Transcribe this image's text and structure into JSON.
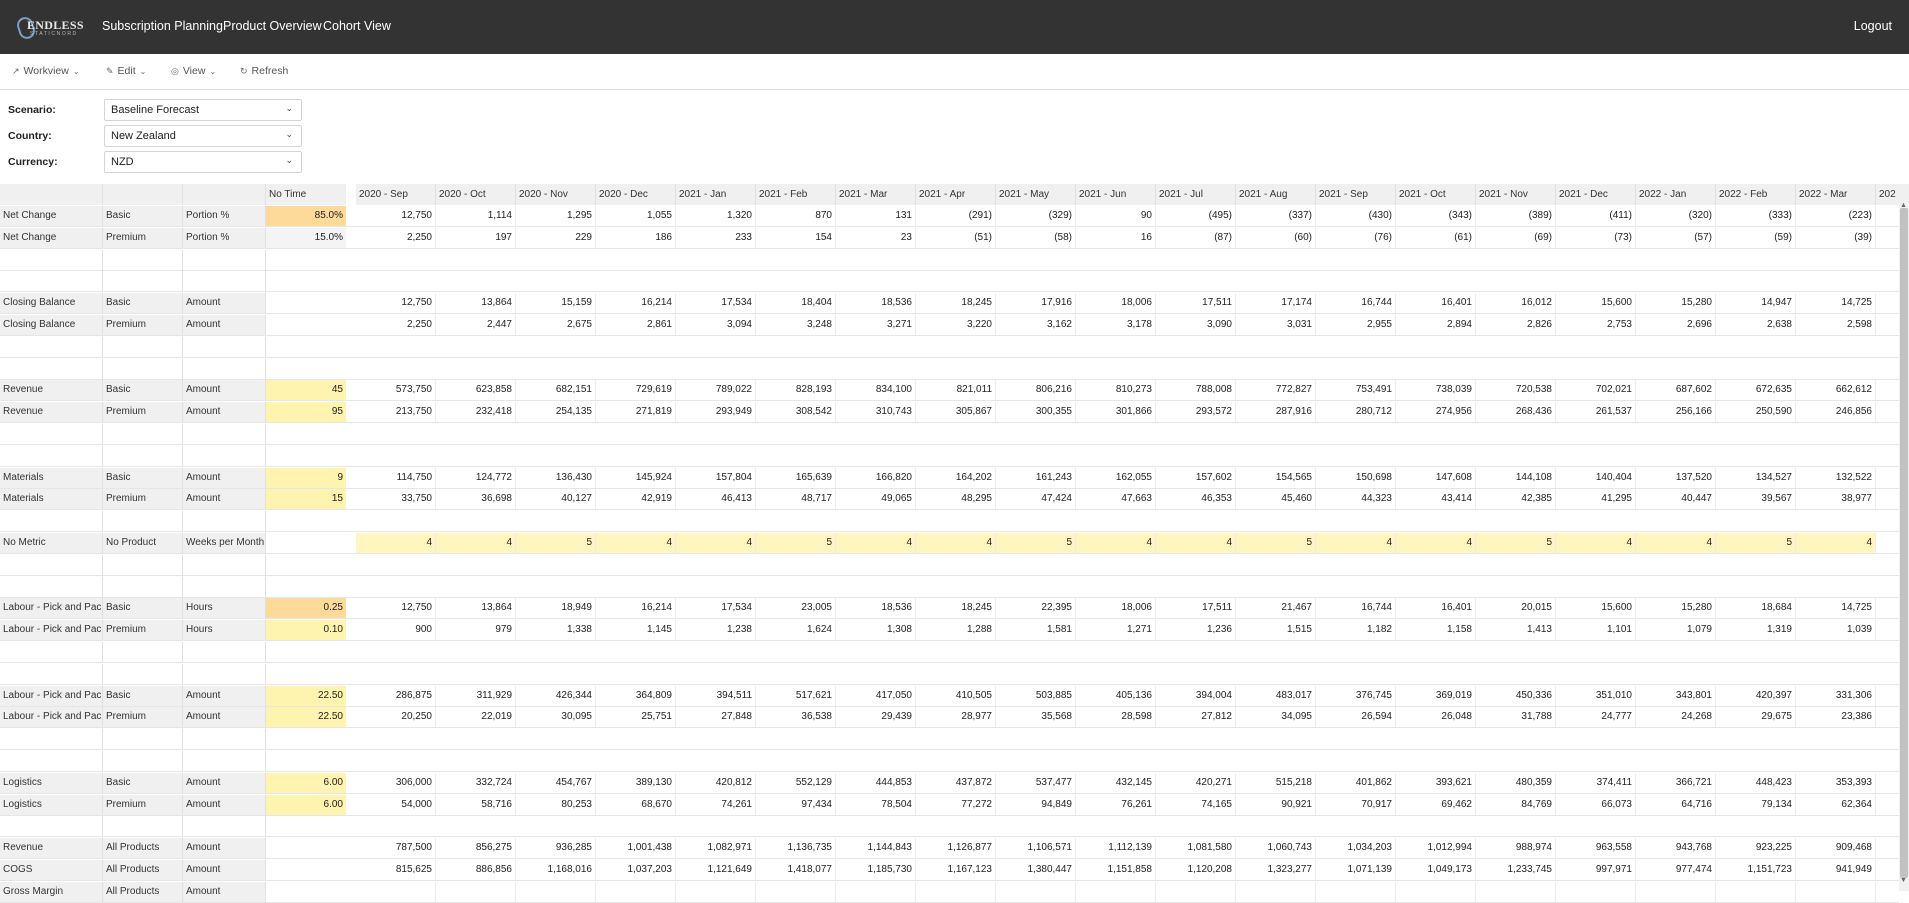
{
  "app": {
    "logo_text": "ENDLESS",
    "logo_subtext": "STATICNORD",
    "nav": [
      "Subscription Planning",
      "Product Overview",
      "Cohort View"
    ],
    "logout": "Logout"
  },
  "toolbar": [
    "Workview",
    "Edit",
    "View",
    "Refresh"
  ],
  "filters": [
    {
      "label": "Scenario:",
      "value": "Baseline Forecast"
    },
    {
      "label": "Country:",
      "value": "New Zealand"
    },
    {
      "label": "Currency:",
      "value": "NZD"
    }
  ],
  "grid": {
    "no_time_header": "No Time",
    "columns": [
      "2020 - Sep",
      "2020 - Oct",
      "2020 - Nov",
      "2020 - Dec",
      "2021 - Jan",
      "2021 - Feb",
      "2021 - Mar",
      "2021 - Apr",
      "2021 - May",
      "2021 - Jun",
      "2021 - Jul",
      "2021 - Aug",
      "2021 - Sep",
      "2021 - Oct",
      "2021 - Nov",
      "2021 - Dec",
      "2022 - Jan",
      "2022 - Feb",
      "2022 - Mar",
      "202"
    ],
    "rows": [
      {
        "m": "Net Change",
        "p": "Basic",
        "t": "Portion %",
        "nt": "85.0%",
        "ntc": "#fdd99a",
        "v": [
          "12,750",
          "1,114",
          "1,295",
          "1,055",
          "1,320",
          "870",
          "131",
          "(291)",
          "(329)",
          "90",
          "(495)",
          "(337)",
          "(430)",
          "(343)",
          "(389)",
          "(411)",
          "(320)",
          "(333)",
          "(223)"
        ]
      },
      {
        "m": "Net Change",
        "p": "Premium",
        "t": "Portion %",
        "nt": "15.0%",
        "ntc": "#f4f4f4",
        "v": [
          "2,250",
          "197",
          "229",
          "186",
          "233",
          "154",
          "23",
          "(51)",
          "(58)",
          "16",
          "(87)",
          "(60)",
          "(76)",
          "(61)",
          "(69)",
          "(73)",
          "(57)",
          "(59)",
          "(39)"
        ]
      },
      {
        "blank": true
      },
      {
        "blank": true
      },
      {
        "m": "Closing Balance",
        "p": "Basic",
        "t": "Amount",
        "v": [
          "12,750",
          "13,864",
          "15,159",
          "16,214",
          "17,534",
          "18,404",
          "18,536",
          "18,245",
          "17,916",
          "18,006",
          "17,511",
          "17,174",
          "16,744",
          "16,401",
          "16,012",
          "15,600",
          "15,280",
          "14,947",
          "14,725"
        ]
      },
      {
        "m": "Closing Balance",
        "p": "Premium",
        "t": "Amount",
        "v": [
          "2,250",
          "2,447",
          "2,675",
          "2,861",
          "3,094",
          "3,248",
          "3,271",
          "3,220",
          "3,162",
          "3,178",
          "3,090",
          "3,031",
          "2,955",
          "2,894",
          "2,826",
          "2,753",
          "2,696",
          "2,638",
          "2,598"
        ]
      },
      {
        "blank": true
      },
      {
        "blank": true
      },
      {
        "m": "Revenue",
        "p": "Basic",
        "t": "Amount",
        "nt": "45",
        "ntc": "#fff3b0",
        "v": [
          "573,750",
          "623,858",
          "682,151",
          "729,619",
          "789,022",
          "828,193",
          "834,100",
          "821,011",
          "806,216",
          "810,273",
          "788,008",
          "772,827",
          "753,491",
          "738,039",
          "720,538",
          "702,021",
          "687,602",
          "672,635",
          "662,612"
        ]
      },
      {
        "m": "Revenue",
        "p": "Premium",
        "t": "Amount",
        "nt": "95",
        "ntc": "#fff3b0",
        "v": [
          "213,750",
          "232,418",
          "254,135",
          "271,819",
          "293,949",
          "308,542",
          "310,743",
          "305,867",
          "300,355",
          "301,866",
          "293,572",
          "287,916",
          "280,712",
          "274,956",
          "268,436",
          "261,537",
          "256,166",
          "250,590",
          "246,856"
        ]
      },
      {
        "blank": true
      },
      {
        "blank": true
      },
      {
        "m": "Materials",
        "p": "Basic",
        "t": "Amount",
        "nt": "9",
        "ntc": "#fff3b0",
        "v": [
          "114,750",
          "124,772",
          "136,430",
          "145,924",
          "157,804",
          "165,639",
          "166,820",
          "164,202",
          "161,243",
          "162,055",
          "157,602",
          "154,565",
          "150,698",
          "147,608",
          "144,108",
          "140,404",
          "137,520",
          "134,527",
          "132,522"
        ]
      },
      {
        "m": "Materials",
        "p": "Premium",
        "t": "Amount",
        "nt": "15",
        "ntc": "#fff3b0",
        "v": [
          "33,750",
          "36,698",
          "40,127",
          "42,919",
          "46,413",
          "48,717",
          "49,065",
          "48,295",
          "47,424",
          "47,663",
          "46,353",
          "45,460",
          "44,323",
          "43,414",
          "42,385",
          "41,295",
          "40,447",
          "39,567",
          "38,977"
        ]
      },
      {
        "blank": true
      },
      {
        "m": "No Metric",
        "p": "No Product",
        "t": "Weeks per Month",
        "yellow": true,
        "v": [
          "4",
          "4",
          "5",
          "4",
          "4",
          "5",
          "4",
          "4",
          "5",
          "4",
          "4",
          "5",
          "4",
          "4",
          "5",
          "4",
          "4",
          "5",
          "4"
        ]
      },
      {
        "blank": true
      },
      {
        "blank": true
      },
      {
        "m": "Labour - Pick and Pack",
        "p": "Basic",
        "t": "Hours",
        "nt": "0.25",
        "ntc": "#fdd99a",
        "v": [
          "12,750",
          "13,864",
          "18,949",
          "16,214",
          "17,534",
          "23,005",
          "18,536",
          "18,245",
          "22,395",
          "18,006",
          "17,511",
          "21,467",
          "16,744",
          "16,401",
          "20,015",
          "15,600",
          "15,280",
          "18,684",
          "14,725"
        ]
      },
      {
        "m": "Labour - Pick and Pack",
        "p": "Premium",
        "t": "Hours",
        "nt": "0.10",
        "ntc": "#fff3b0",
        "v": [
          "900",
          "979",
          "1,338",
          "1,145",
          "1,238",
          "1,624",
          "1,308",
          "1,288",
          "1,581",
          "1,271",
          "1,236",
          "1,515",
          "1,182",
          "1,158",
          "1,413",
          "1,101",
          "1,079",
          "1,319",
          "1,039"
        ]
      },
      {
        "blank": true
      },
      {
        "blank": true
      },
      {
        "m": "Labour - Pick and Pack",
        "p": "Basic",
        "t": "Amount",
        "nt": "22.50",
        "ntc": "#fff3b0",
        "v": [
          "286,875",
          "311,929",
          "426,344",
          "364,809",
          "394,511",
          "517,621",
          "417,050",
          "410,505",
          "503,885",
          "405,136",
          "394,004",
          "483,017",
          "376,745",
          "369,019",
          "450,336",
          "351,010",
          "343,801",
          "420,397",
          "331,306"
        ]
      },
      {
        "m": "Labour - Pick and Pack",
        "p": "Premium",
        "t": "Amount",
        "nt": "22.50",
        "ntc": "#fff3b0",
        "v": [
          "20,250",
          "22,019",
          "30,095",
          "25,751",
          "27,848",
          "36,538",
          "29,439",
          "28,977",
          "35,568",
          "28,598",
          "27,812",
          "34,095",
          "26,594",
          "26,048",
          "31,788",
          "24,777",
          "24,268",
          "29,675",
          "23,386"
        ]
      },
      {
        "blank": true
      },
      {
        "blank": true
      },
      {
        "m": "Logistics",
        "p": "Basic",
        "t": "Amount",
        "nt": "6.00",
        "ntc": "#fff3b0",
        "v": [
          "306,000",
          "332,724",
          "454,767",
          "389,130",
          "420,812",
          "552,129",
          "444,853",
          "437,872",
          "537,477",
          "432,145",
          "420,271",
          "515,218",
          "401,862",
          "393,621",
          "480,359",
          "374,411",
          "366,721",
          "448,423",
          "353,393"
        ]
      },
      {
        "m": "Logistics",
        "p": "Premium",
        "t": "Amount",
        "nt": "6.00",
        "ntc": "#fff3b0",
        "v": [
          "54,000",
          "58,716",
          "80,253",
          "68,670",
          "74,261",
          "97,434",
          "78,504",
          "77,272",
          "94,849",
          "76,261",
          "74,165",
          "90,921",
          "70,917",
          "69,462",
          "84,769",
          "66,073",
          "64,716",
          "79,134",
          "62,364"
        ]
      },
      {
        "blank": true
      },
      {
        "m": "Revenue",
        "p": "All Products",
        "t": "Amount",
        "v": [
          "787,500",
          "856,275",
          "936,285",
          "1,001,438",
          "1,082,971",
          "1,136,735",
          "1,144,843",
          "1,126,877",
          "1,106,571",
          "1,112,139",
          "1,081,580",
          "1,060,743",
          "1,034,203",
          "1,012,994",
          "988,974",
          "963,558",
          "943,768",
          "923,225",
          "909,468"
        ]
      },
      {
        "m": "COGS",
        "p": "All Products",
        "t": "Amount",
        "v": [
          "815,625",
          "886,856",
          "1,168,016",
          "1,037,203",
          "1,121,649",
          "1,418,077",
          "1,185,730",
          "1,167,123",
          "1,380,447",
          "1,151,858",
          "1,120,208",
          "1,323,277",
          "1,071,139",
          "1,049,173",
          "1,233,745",
          "997,971",
          "977,474",
          "1,151,723",
          "941,949"
        ]
      },
      {
        "m": "Gross Margin",
        "p": "All Products",
        "t": "Amount",
        "v": [
          "",
          "",
          "",
          "",
          "",
          "",
          "",
          "",
          "",
          "",
          "",
          "",
          "",
          "",
          "",
          "",
          "",
          "",
          ""
        ]
      }
    ]
  }
}
